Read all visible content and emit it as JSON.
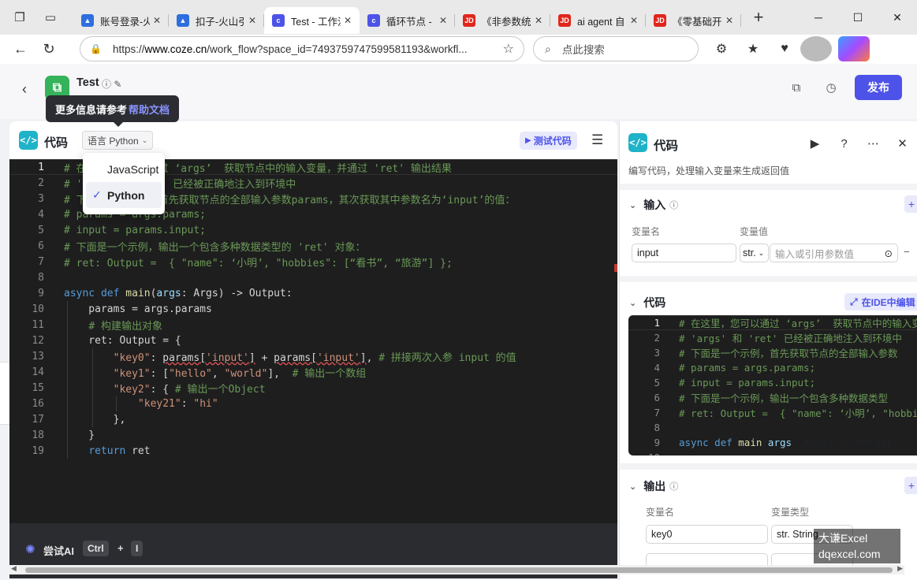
{
  "browser": {
    "tabs": [
      {
        "label": "账号登录-火",
        "fav": "▲",
        "favcolor": "#2e6fe0"
      },
      {
        "label": "扣子-火山引",
        "fav": "▲",
        "favcolor": "#2e6fe0"
      },
      {
        "label": "Test - 工作流",
        "fav": "c",
        "favcolor": "#4d53e8",
        "active": true
      },
      {
        "label": "循环节点 -",
        "fav": "c",
        "favcolor": "#4d53e8"
      },
      {
        "label": "《非参数统",
        "fav": "JD",
        "favcolor": "#e1251b"
      },
      {
        "label": "ai agent 自",
        "fav": "JD",
        "favcolor": "#e1251b"
      },
      {
        "label": "《零基础开",
        "fav": "JD",
        "favcolor": "#e1251b"
      }
    ],
    "url_prefix": "https://",
    "url_host": "www.coze.cn",
    "url_rest": "/work_flow?space_id=7493759747599581193&workfl...",
    "search_placeholder": "点此搜索"
  },
  "app": {
    "title": "Test",
    "publish_label": "发布",
    "tooltip_text": "更多信息请参考",
    "tooltip_link": "帮助文档"
  },
  "left_panel": {
    "title": "代码",
    "lang_select": "语言 Python",
    "test_button": "测试代码",
    "dropdown_options": [
      "JavaScript",
      "Python"
    ],
    "selected_option": "Python",
    "ai_label": "尝试AI",
    "kbd_ctrl": "Ctrl",
    "kbd_plus": "+",
    "kbd_i": "I"
  },
  "right_panel": {
    "title": "代码",
    "description": "编写代码，处理输入变量来生成返回值",
    "input_section": "输入",
    "col_var_name": "变量名",
    "col_var_value": "变量值",
    "input_name": "input",
    "input_type": "str.",
    "input_value_placeholder": "输入或引用参数值",
    "code_section": "代码",
    "ide_button": "在IDE中编辑",
    "output_section": "输出",
    "col_out_name": "变量名",
    "col_out_type": "变量类型",
    "output_name": "key0",
    "output_type": "str. String"
  },
  "watermark": {
    "line1": "大谦Excel",
    "line2": "dqexcel.com"
  }
}
